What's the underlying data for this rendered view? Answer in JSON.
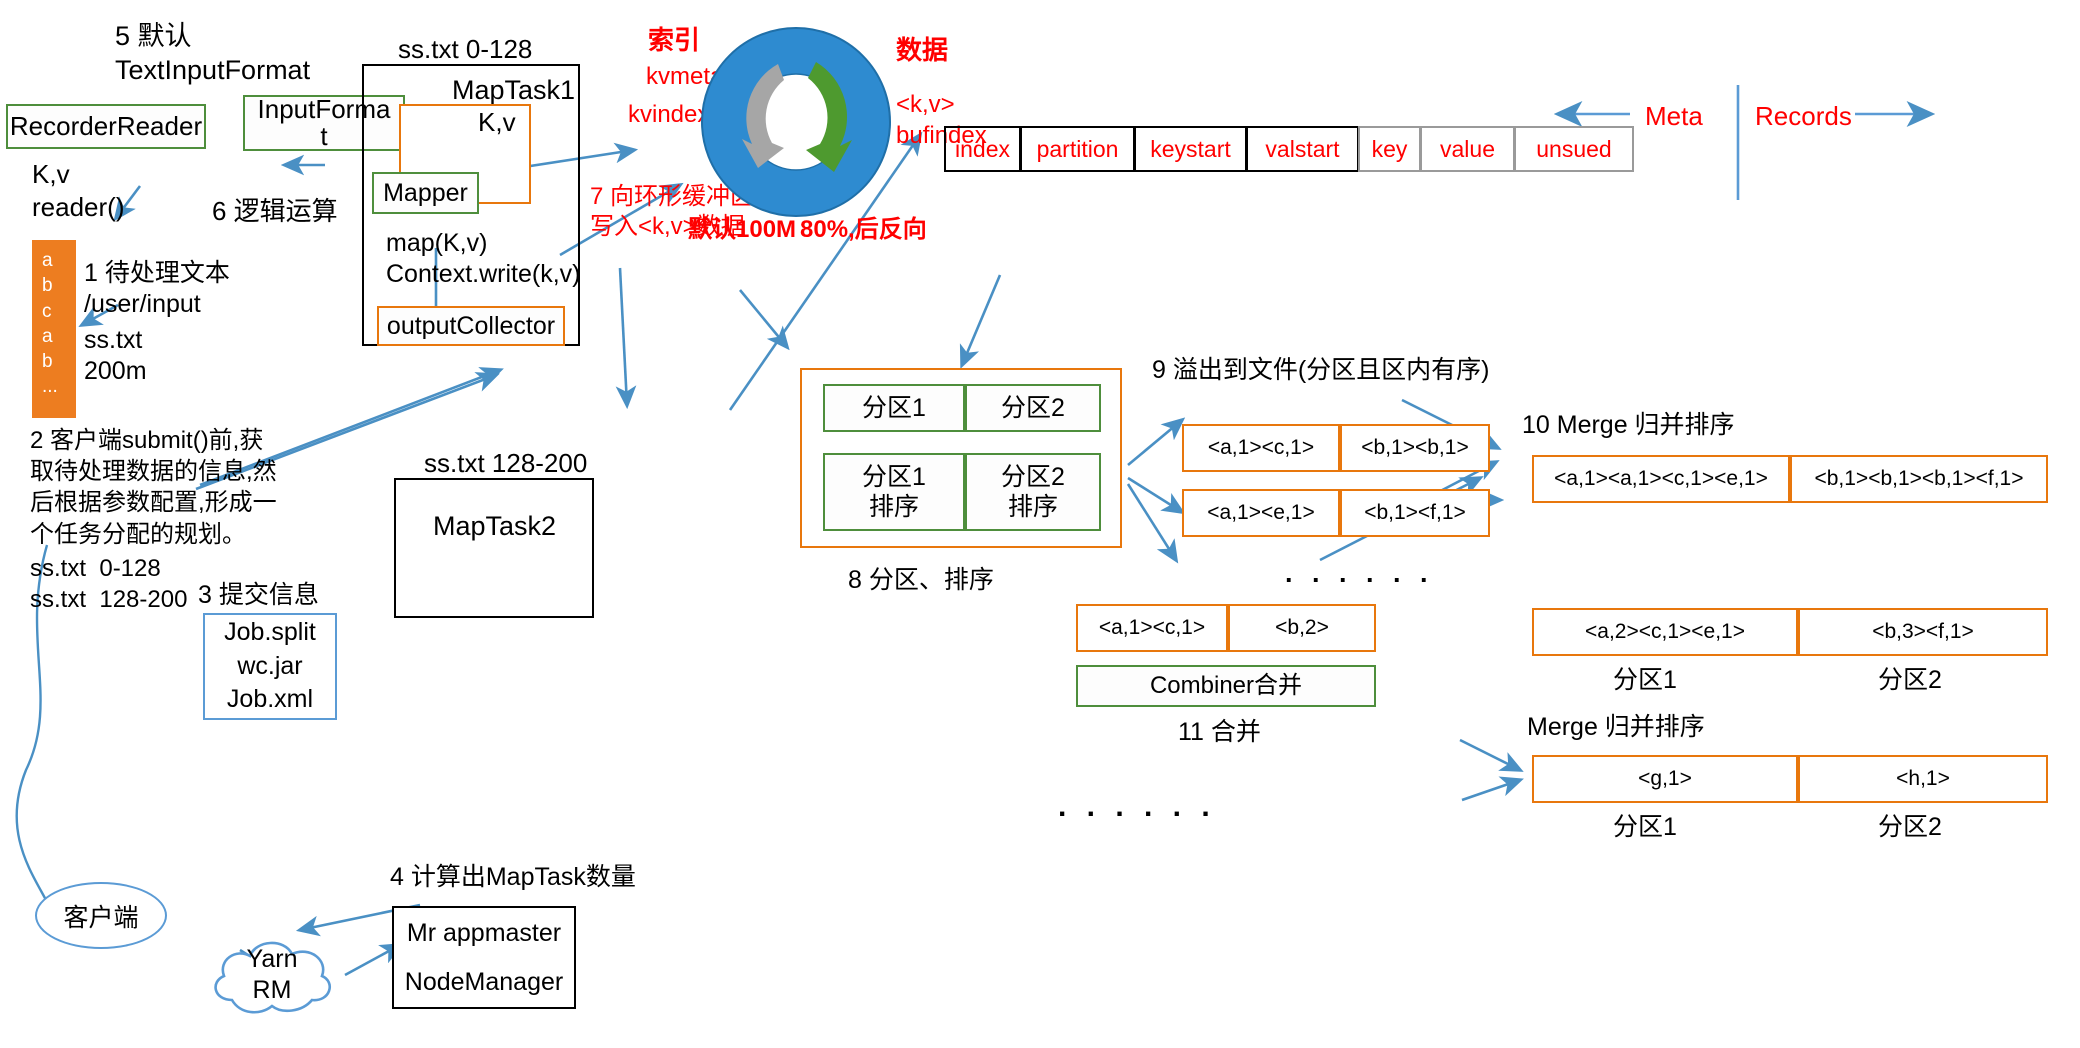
{
  "colors": {
    "green": "#4E8E3C",
    "orange": "#E8770D",
    "blue": "#5B9BD5",
    "red": "#FF0000",
    "black": "#000000",
    "orange_fill": "#ED7D20",
    "ring_blue": "#2E8BD0",
    "ring_green": "#4E9A2F",
    "ring_gray": "#A6A6A6"
  },
  "steps": {
    "s5": "5 默认\nTextInputFormat",
    "s6": "6 逻辑运算",
    "s1": "1 待处理文本\n/user/input",
    "s1b": "ss.txt\n200m",
    "s2": "2 客户端submit()前,获\n取待处理数据的信息,然\n后根据参数配置,形成一\n个任务分配的规划。",
    "s2b": "ss.txt  0-128\nss.txt  128-200",
    "s3": "3 提交信息",
    "s4": "4 计算出MapTask数量",
    "s7": "7 向环形缓冲区\n写入<k,v>数据",
    "s8": "8 分区、排序",
    "s9": "9 溢出到文件(分区且区内有序)",
    "s10": "10 Merge 归并排序",
    "s11": "11 合并",
    "merge2": "Merge 归并排序"
  },
  "boxes": {
    "recorder_reader": "RecorderReader",
    "input_format": "InputFormat",
    "mapper": "Mapper",
    "output_collector": "outputCollector",
    "maptask1": "MapTask1",
    "maptask2": "MapTask2",
    "job_files": [
      "Job.split",
      "wc.jar",
      "Job.xml"
    ],
    "client": "客户端",
    "yarn": "Yarn\nRM",
    "appmaster": [
      "Mr appmaster",
      "NodeManager"
    ]
  },
  "labels": {
    "kv_reader": "K,v\nreader()",
    "kv_maptask": "K,v",
    "map_write": "map(K,v)\nContext.write(k,v)",
    "split1": "ss.txt 0-128",
    "split2": "ss.txt 128-200",
    "text_block": "a\nb\nc\na\nb\n..."
  },
  "ring": {
    "index_title": "索引",
    "kvmeta": "kvmeta",
    "kvindex": "kvindex",
    "data_title": "数据",
    "kv": "<k,v>",
    "bufindex": "bufindex",
    "default_size": "默认100M",
    "spill_pct": "80%,后反向"
  },
  "meta_table": {
    "meta_label": "Meta",
    "records_label": "Records",
    "meta_cells": [
      "index",
      "partition",
      "keystart",
      "valstart"
    ],
    "record_cells": [
      "key",
      "value",
      "unsued"
    ]
  },
  "partition_panel": {
    "row1": [
      "分区1",
      "分区2"
    ],
    "row2": [
      "分区1\n排序",
      "分区2\n排序"
    ]
  },
  "spill": {
    "file1": [
      "<a,1><c,1>",
      "<b,1><b,1>"
    ],
    "file2": [
      "<a,1><e,1>",
      "<b,1><f,1>"
    ],
    "dots": ". . .   . . ."
  },
  "merge": {
    "merged": [
      "<a,1><a,1><c,1><e,1>",
      "<b,1><b,1><b,1><f,1>"
    ]
  },
  "combine": {
    "source": [
      "<a,1><c,1>",
      "<b,2>"
    ],
    "combiner_label": "Combiner合并",
    "result": [
      "<a,2><c,1><e,1>",
      "<b,3><f,1>"
    ],
    "result_captions": [
      "分区1",
      "分区2"
    ],
    "final": [
      "<g,1>",
      "<h,1>"
    ],
    "final_captions": [
      "分区1",
      "分区2"
    ],
    "bottom_dots": ". . .   . . ."
  }
}
